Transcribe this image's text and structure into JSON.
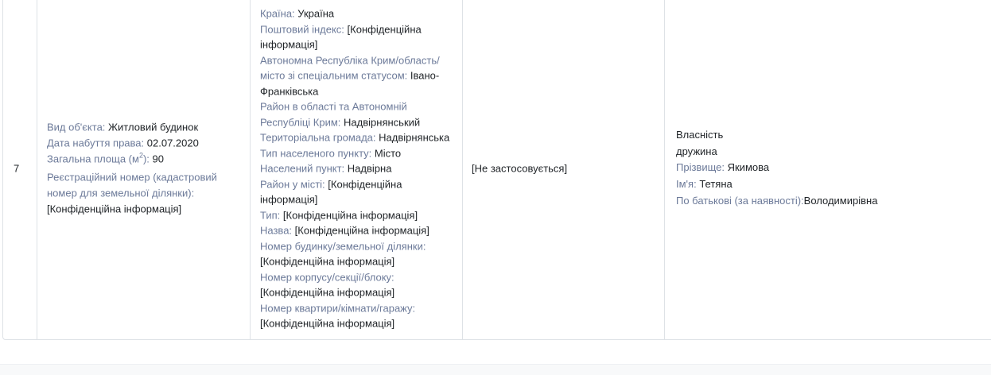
{
  "row": {
    "number": "7",
    "object": {
      "type_label": "Вид об'єкта:",
      "type_value": "Житловий будинок",
      "date_label": "Дата набуття права:",
      "date_value": "02.07.2020",
      "area_label_prefix": "Загальна площа (м",
      "area_label_sup": "2",
      "area_label_suffix": "):",
      "area_value": "90",
      "reg_label": "Реєстраційний номер (кадастровий номер для земельної ділянки):",
      "reg_value": "[Конфіденційна інформація]"
    },
    "address": [
      {
        "label": "Країна:",
        "value": "Україна"
      },
      {
        "label": "Поштовий індекс:",
        "value": "[Конфіденційна інформація]"
      },
      {
        "label": "Автономна Республіка Крим/область/ місто зі спеціальним статусом:",
        "value": "Івано-Франківська"
      },
      {
        "label": "Район в області та Автономній Республіці Крим:",
        "value": "Надвірнянський"
      },
      {
        "label": "Територіальна громада:",
        "value": "Надвірнянська"
      },
      {
        "label": "Тип населеного пункту:",
        "value": "Місто"
      },
      {
        "label": "Населений пункт:",
        "value": "Надвірна"
      },
      {
        "label": "Район у місті:",
        "value": "[Конфіденційна інформація]"
      },
      {
        "label": "Тип:",
        "value": "[Конфіденційна інформація]"
      },
      {
        "label": "Назва:",
        "value": "[Конфіденційна інформація]"
      },
      {
        "label": "Номер будинку/земельної ділянки:",
        "value": "[Конфіденційна інформація]"
      },
      {
        "label": "Номер корпусу/секції/блоку:",
        "value": "[Конфіденційна інформація]"
      },
      {
        "label": "Номер квартири/кімнати/гаражу:",
        "value": "[Конфіденційна інформація]"
      }
    ],
    "cost": "[Не застосовується]",
    "owner": {
      "right_type": "Власність",
      "relation": "дружина",
      "surname_label": "Прізвище:",
      "surname_value": "Якимова",
      "name_label": "Ім'я:",
      "name_value": "Тетяна",
      "patronymic_label": "По батькові (за наявності):",
      "patronymic_value": "Володимирівна"
    }
  }
}
